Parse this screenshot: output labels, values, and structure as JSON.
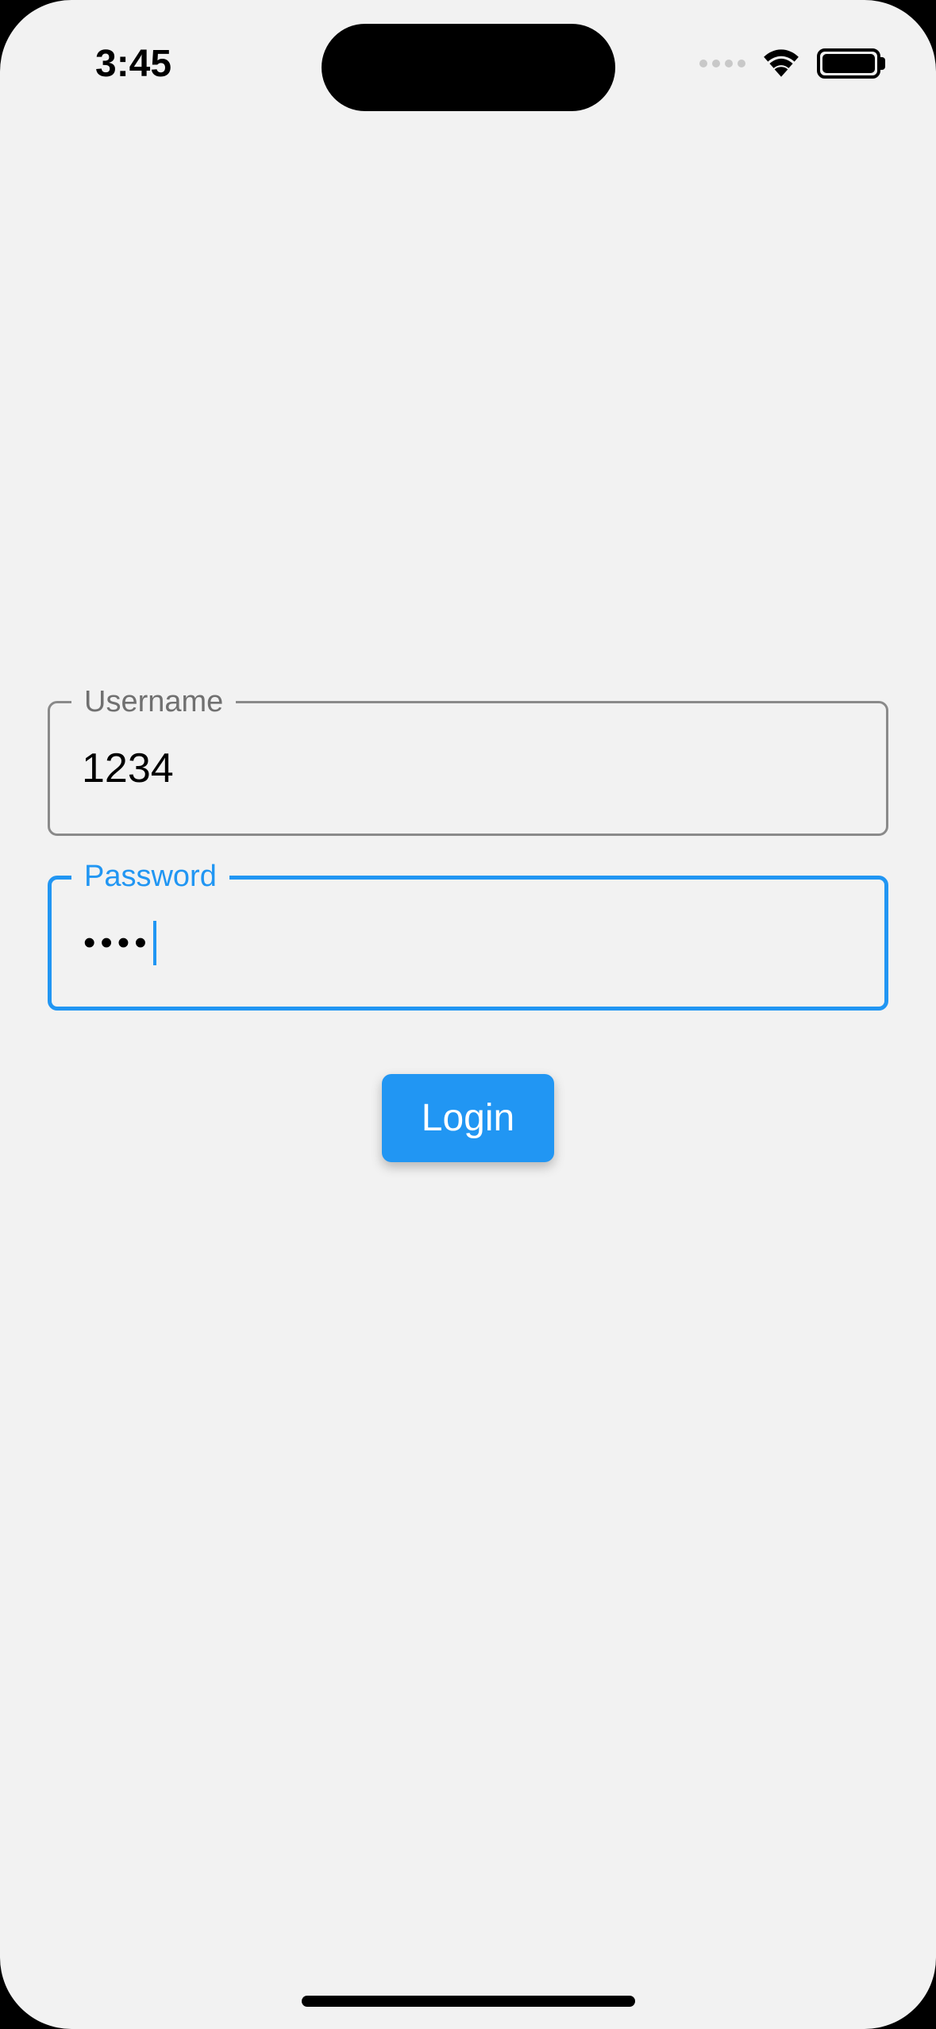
{
  "status_bar": {
    "time": "3:45"
  },
  "form": {
    "username": {
      "label": "Username",
      "value": "1234"
    },
    "password": {
      "label": "Password",
      "masked_value": "••••"
    },
    "login_label": "Login"
  },
  "colors": {
    "accent": "#2196f3",
    "background": "#f2f2f2",
    "border_inactive": "#8a8a8a"
  }
}
